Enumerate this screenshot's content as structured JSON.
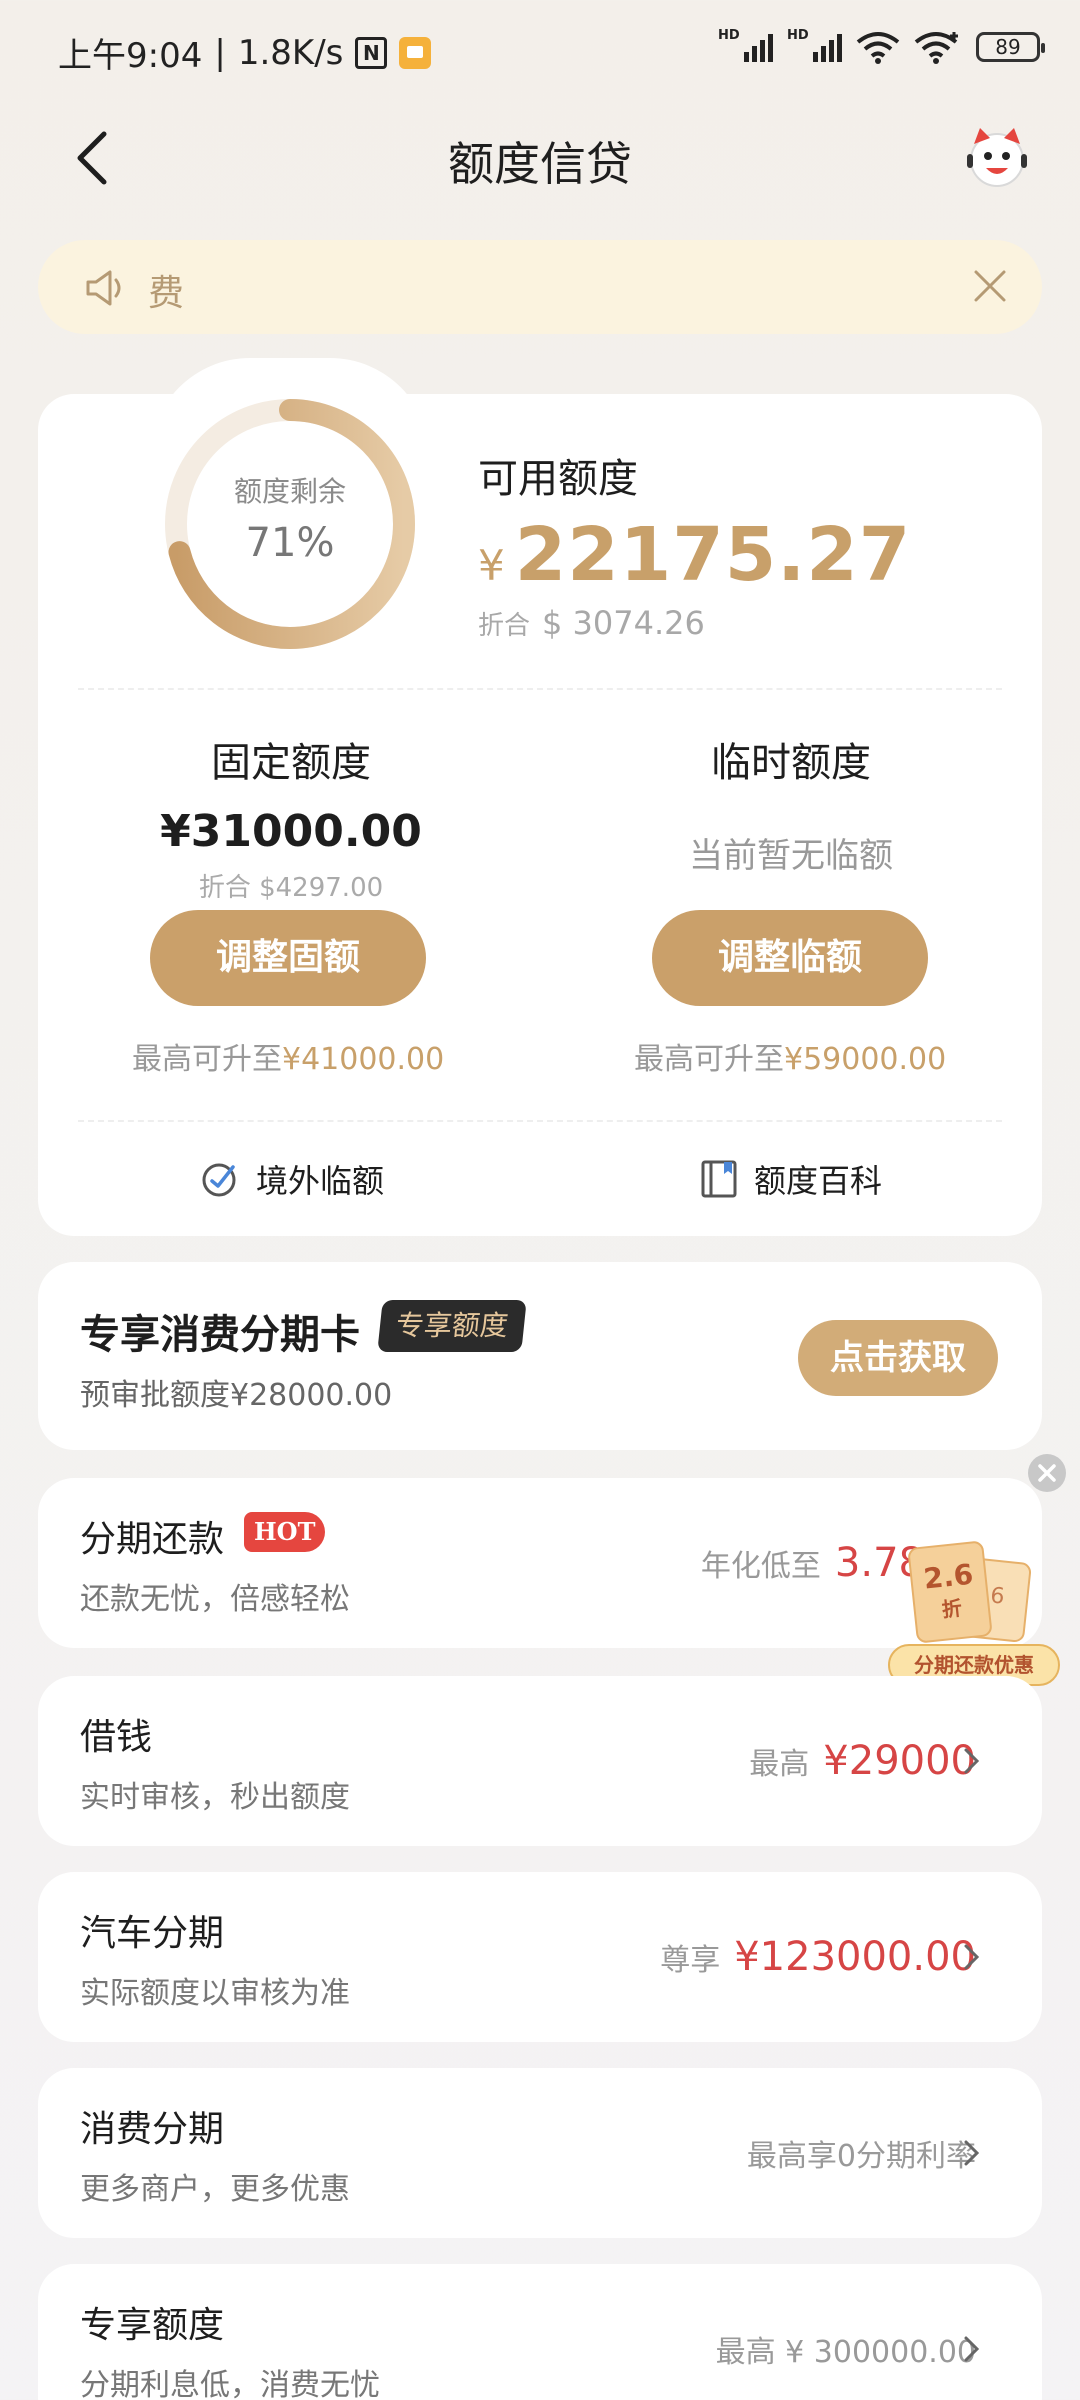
{
  "status_bar": {
    "time": "上午9:04",
    "speed": "1.8K/s",
    "nfc": "N",
    "signal_tag": "HD",
    "battery": "89"
  },
  "header": {
    "title": "额度信贷"
  },
  "notice": {
    "text": "费"
  },
  "credit": {
    "ring_label": "额度剩余",
    "ring_value": "71%",
    "ring_fraction": 0.71,
    "available_label": "可用额度",
    "available_currency": "¥",
    "available_amount": "22175.27",
    "equiv_prefix": "折合",
    "equiv_amount": "$ 3074.26",
    "fixed": {
      "title": "固定额度",
      "amount": "¥31000.00",
      "equiv": "折合 $4297.00",
      "button": "调整固额",
      "max_prefix": "最高可升至",
      "max_value": "¥41000.00"
    },
    "temporary": {
      "title": "临时额度",
      "none_text": "当前暂无临额",
      "button": "调整临额",
      "max_prefix": "最高可升至",
      "max_value": "¥59000.00"
    },
    "links": {
      "overseas": "境外临额",
      "wiki": "额度百科"
    }
  },
  "installment_card": {
    "title": "专享消费分期卡",
    "tag": "专享额度",
    "subtitle": "预审批额度¥28000.00",
    "button": "点击获取"
  },
  "products": [
    {
      "title": "分期还款",
      "tag": "HOT",
      "subtitle": "还款无忧，倍感轻松",
      "right_prefix": "年化低至",
      "right_value": "3.78%"
    },
    {
      "title": "借钱",
      "subtitle": "实时审核，秒出额度",
      "right_prefix": "最高",
      "right_value": "¥29000"
    },
    {
      "title": "汽车分期",
      "subtitle": "实际额度以审核为准",
      "right_prefix": "尊享",
      "right_value": "¥123000.00"
    },
    {
      "title": "消费分期",
      "subtitle": "更多商户，更多优惠",
      "right_text": "最高享0分期利率"
    },
    {
      "title": "专享额度",
      "subtitle": "分期利息低，消费无忧",
      "right_text": "最高 ¥ 300000.00"
    }
  ],
  "promo": {
    "discount": "2.6",
    "unit": "折",
    "back_text": "6",
    "label": "分期还款优惠"
  },
  "colors": {
    "accent_gold": "#caa06a",
    "highlight_red": "#d64545",
    "notice_bg": "#fbf3df"
  }
}
